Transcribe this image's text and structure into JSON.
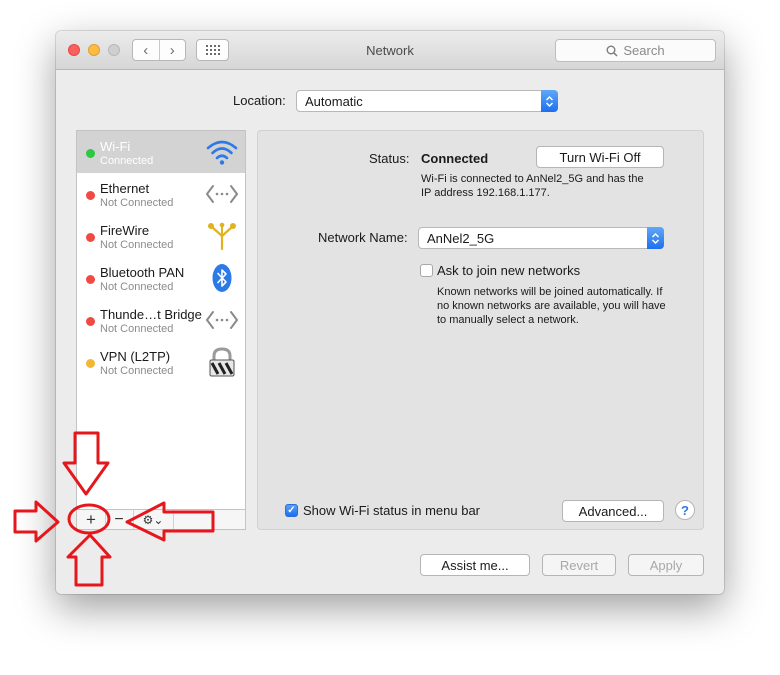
{
  "window": {
    "title": "Network"
  },
  "toolbar": {
    "back": "‹",
    "forward": "›",
    "search_placeholder": "Search"
  },
  "location": {
    "label": "Location:",
    "value": "Automatic"
  },
  "services": [
    {
      "name": "Wi-Fi",
      "status": "Connected",
      "dot": "#2bc840",
      "icon": "wifi-icon",
      "selected": true
    },
    {
      "name": "Ethernet",
      "status": "Not Connected",
      "dot": "#f04a45",
      "icon": "ethernet-icon"
    },
    {
      "name": "FireWire",
      "status": "Not Connected",
      "dot": "#f04a45",
      "icon": "firewire-icon"
    },
    {
      "name": "Bluetooth PAN",
      "status": "Not Connected",
      "dot": "#f04a45",
      "icon": "bluetooth-icon"
    },
    {
      "name": "Thunde…t Bridge",
      "status": "Not Connected",
      "dot": "#f04a45",
      "icon": "thunderbolt-bridge-icon"
    },
    {
      "name": "VPN (L2TP)",
      "status": "Not Connected",
      "dot": "#f2b735",
      "icon": "vpn-lock-icon"
    }
  ],
  "sidebar_bar": {
    "add": "+",
    "remove": "−",
    "gear": "⚙︎⌄"
  },
  "detail": {
    "status_label": "Status:",
    "status_value": "Connected",
    "turn_off_button": "Turn Wi-Fi Off",
    "status_desc_line1": "Wi-Fi is connected to AnNel2_5G and has the",
    "status_desc_line2": "IP address 192.168.1.177.",
    "network_name_label": "Network Name:",
    "network_name_value": "AnNel2_5G",
    "ask_join_label": "Ask to join new networks",
    "ask_join_checked": false,
    "ask_join_desc_line1": "Known networks will be joined automatically. If",
    "ask_join_desc_line2": "no known networks are available, you will have",
    "ask_join_desc_line3": "to manually select a network.",
    "show_status_label": "Show Wi-Fi status in menu bar",
    "show_status_checked": true,
    "advanced_button": "Advanced...",
    "help_button": "?"
  },
  "footer": {
    "assist": "Assist me...",
    "revert": "Revert",
    "apply": "Apply"
  },
  "colors": {
    "accent": "#1c6ff0",
    "annotation": "#e5171c"
  }
}
